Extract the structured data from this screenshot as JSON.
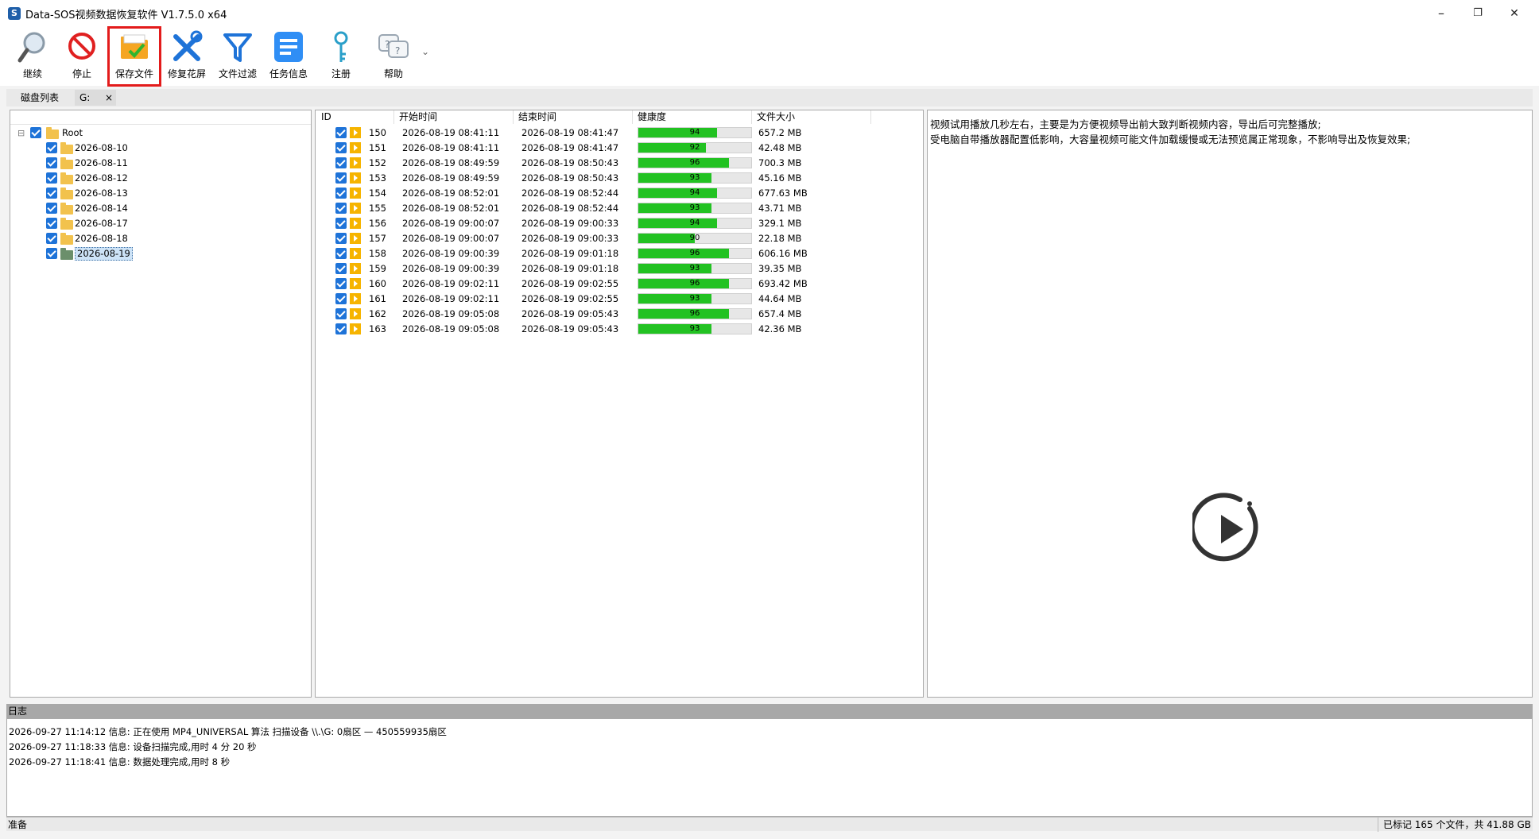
{
  "window": {
    "title": "Data-SOS视频数据恢复软件 V1.7.5.0 x64",
    "minimize_glyph": "–",
    "restore_glyph": "❐",
    "close_glyph": "✕"
  },
  "toolbar": {
    "items": [
      {
        "label": "继续",
        "icon": "magnifier-icon"
      },
      {
        "label": "停止",
        "icon": "stop-icon"
      },
      {
        "label": "保存文件",
        "icon": "save-folder-icon",
        "highlighted": true
      },
      {
        "label": "修复花屏",
        "icon": "repair-tools-icon"
      },
      {
        "label": "文件过滤",
        "icon": "filter-icon"
      },
      {
        "label": "任务信息",
        "icon": "task-list-icon"
      },
      {
        "label": "注册",
        "icon": "key-icon"
      },
      {
        "label": "帮助",
        "icon": "help-chat-icon"
      }
    ],
    "dropdown_glyph": "⌄"
  },
  "tabs": {
    "disk_list": "磁盘列表",
    "drive": "G:",
    "close_glyph": "×"
  },
  "tree": {
    "expander": "⊟",
    "root_label": "Root",
    "children": [
      "2026-08-10",
      "2026-08-11",
      "2026-08-12",
      "2026-08-13",
      "2026-08-14",
      "2026-08-17",
      "2026-08-18",
      "2026-08-19"
    ],
    "selected": "2026-08-19"
  },
  "file_list": {
    "headers": [
      "ID",
      "开始时间",
      "结束时间",
      "健康度",
      "文件大小"
    ],
    "rows": [
      {
        "id": "150",
        "start": "2026-08-19 08:41:11",
        "end": "2026-08-19 08:41:47",
        "health": 94,
        "size": "657.2 MB"
      },
      {
        "id": "151",
        "start": "2026-08-19 08:41:11",
        "end": "2026-08-19 08:41:47",
        "health": 92,
        "size": "42.48 MB"
      },
      {
        "id": "152",
        "start": "2026-08-19 08:49:59",
        "end": "2026-08-19 08:50:43",
        "health": 96,
        "size": "700.3 MB"
      },
      {
        "id": "153",
        "start": "2026-08-19 08:49:59",
        "end": "2026-08-19 08:50:43",
        "health": 93,
        "size": "45.16 MB"
      },
      {
        "id": "154",
        "start": "2026-08-19 08:52:01",
        "end": "2026-08-19 08:52:44",
        "health": 94,
        "size": "677.63 MB"
      },
      {
        "id": "155",
        "start": "2026-08-19 08:52:01",
        "end": "2026-08-19 08:52:44",
        "health": 93,
        "size": "43.71 MB"
      },
      {
        "id": "156",
        "start": "2026-08-19 09:00:07",
        "end": "2026-08-19 09:00:33",
        "health": 94,
        "size": "329.1 MB"
      },
      {
        "id": "157",
        "start": "2026-08-19 09:00:07",
        "end": "2026-08-19 09:00:33",
        "health": 90,
        "size": "22.18 MB"
      },
      {
        "id": "158",
        "start": "2026-08-19 09:00:39",
        "end": "2026-08-19 09:01:18",
        "health": 96,
        "size": "606.16 MB"
      },
      {
        "id": "159",
        "start": "2026-08-19 09:00:39",
        "end": "2026-08-19 09:01:18",
        "health": 93,
        "size": "39.35 MB"
      },
      {
        "id": "160",
        "start": "2026-08-19 09:02:11",
        "end": "2026-08-19 09:02:55",
        "health": 96,
        "size": "693.42 MB"
      },
      {
        "id": "161",
        "start": "2026-08-19 09:02:11",
        "end": "2026-08-19 09:02:55",
        "health": 93,
        "size": "44.64 MB"
      },
      {
        "id": "162",
        "start": "2026-08-19 09:05:08",
        "end": "2026-08-19 09:05:43",
        "health": 96,
        "size": "657.4 MB"
      },
      {
        "id": "163",
        "start": "2026-08-19 09:05:08",
        "end": "2026-08-19 09:05:43",
        "health": 93,
        "size": "42.36 MB"
      }
    ]
  },
  "preview": {
    "note_line1": "视频试用播放几秒左右，主要是为方便视频导出前大致判断视频内容，导出后可完整播放;",
    "note_line2": "受电脑自带播放器配置低影响，大容量视频可能文件加载缓慢或无法预览属正常现象，不影响导出及恢复效果;",
    "play_icon": "play-circle-icon"
  },
  "log": {
    "title": "日志",
    "lines": [
      "2026-09-27 11:14:12 信息: 正在使用 MP4_UNIVERSAL 算法 扫描设备 \\\\.\\G: 0扇区 — 450559935扇区",
      "2026-09-27 11:18:33 信息: 设备扫描完成,用时 4 分 20 秒",
      "2026-09-27 11:18:41 信息: 数据处理完成,用时 8 秒"
    ]
  },
  "status": {
    "left": "准备",
    "right": "已标记 165 个文件，共 41.88 GB"
  },
  "colors": {
    "health_bar": "#22c222",
    "checkbox": "#1e73d8",
    "highlight_border": "#e31b1b",
    "folder": "#f2c24d"
  }
}
